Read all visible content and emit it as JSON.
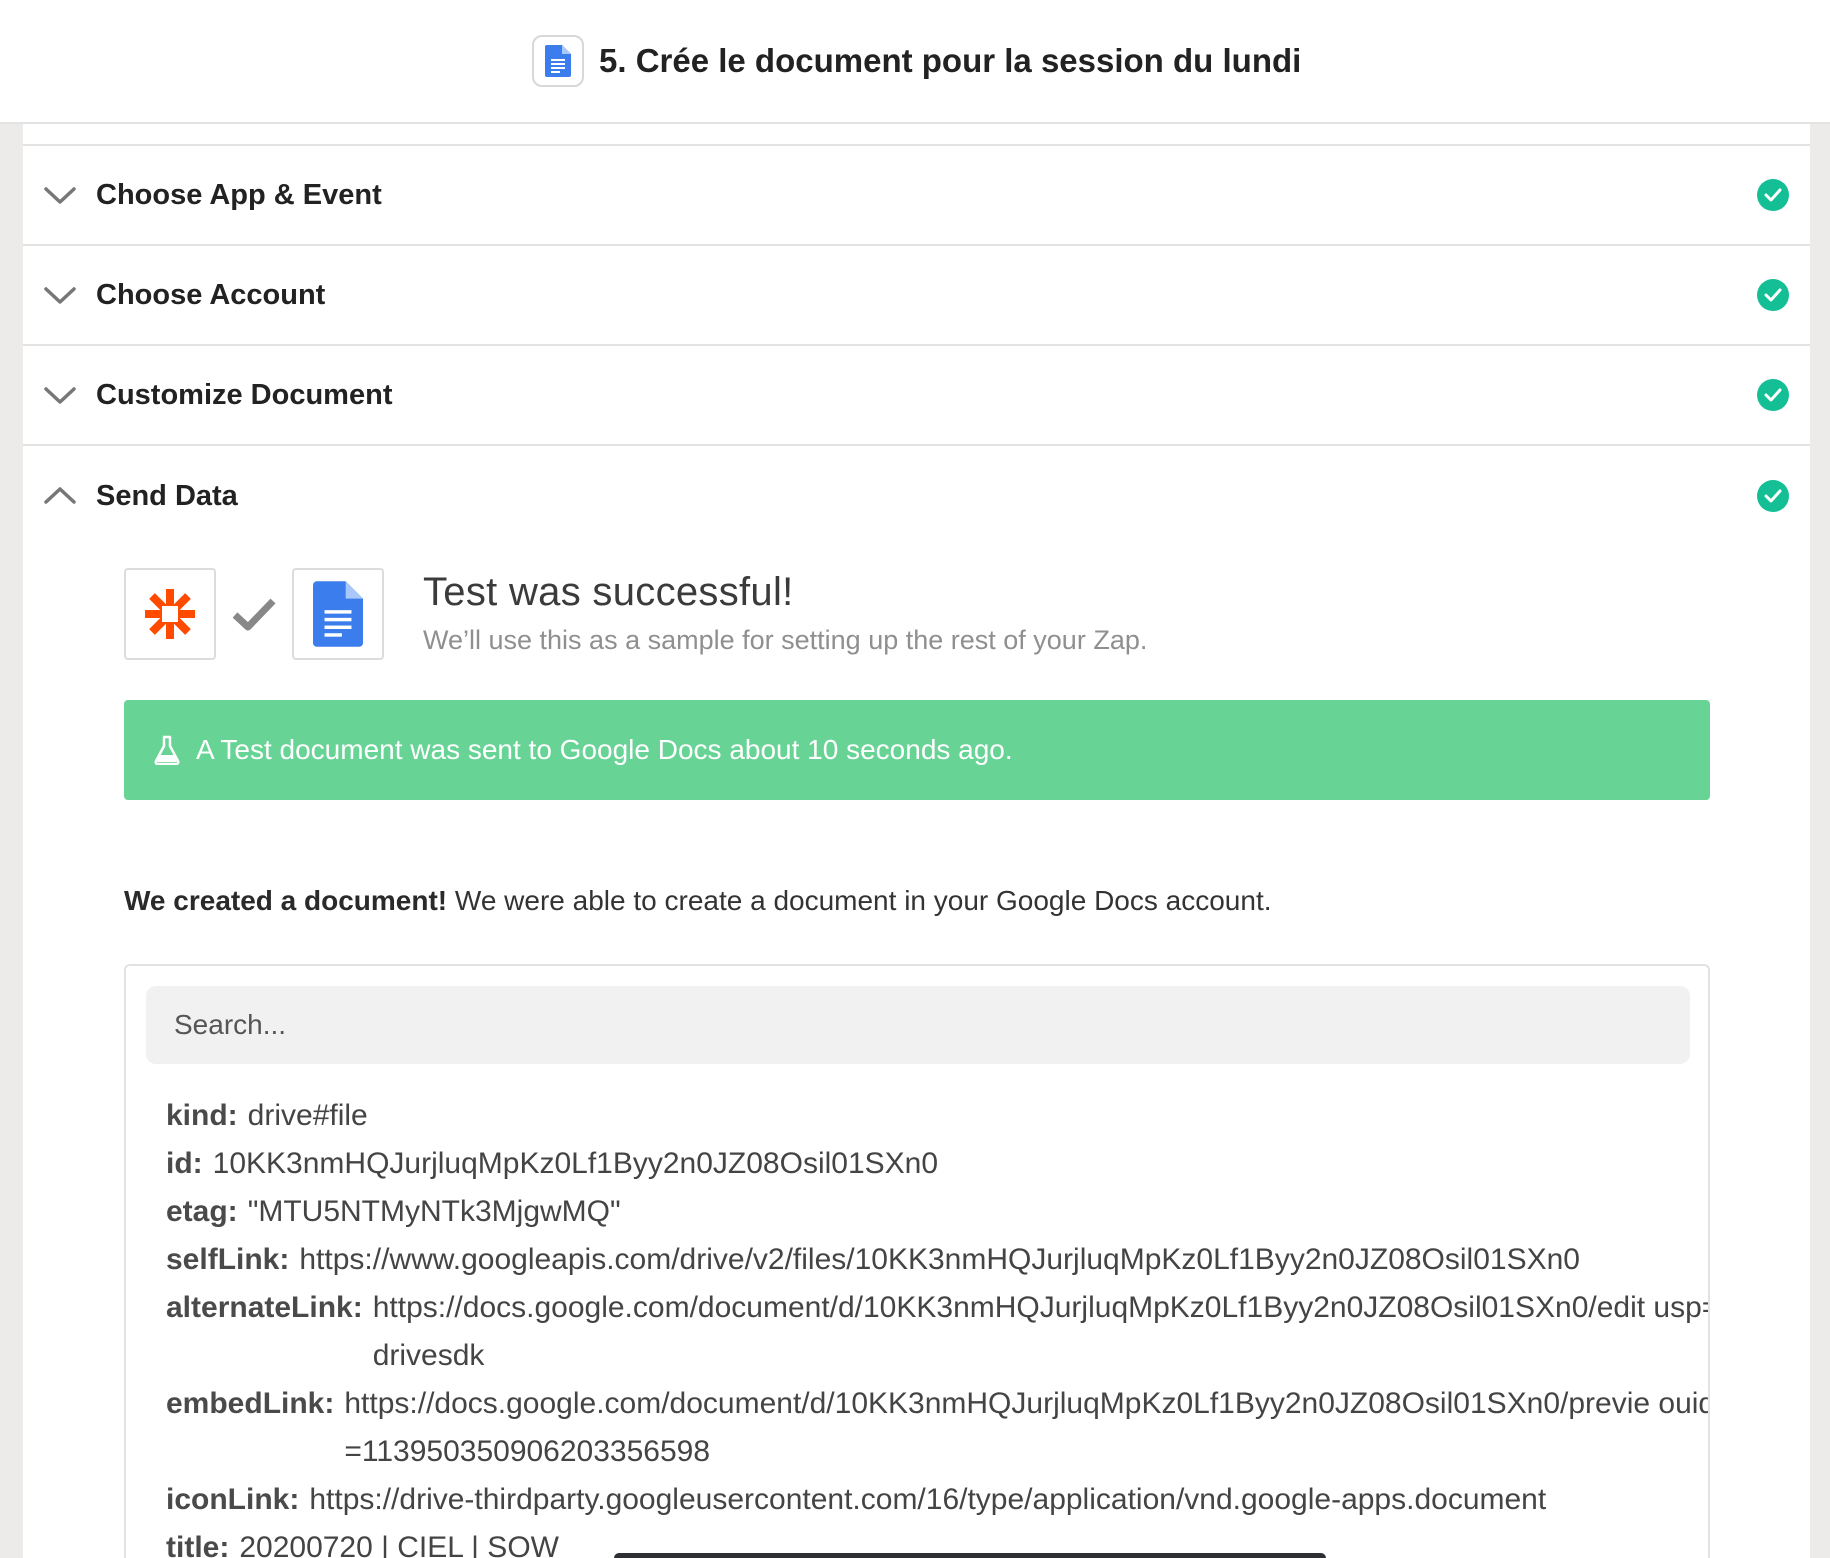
{
  "header": {
    "title": "5. Crée le document pour la session du lundi",
    "icon": "google-docs-icon"
  },
  "sections": [
    {
      "label": "Choose App & Event",
      "state": "collapsed",
      "complete": true
    },
    {
      "label": "Choose Account",
      "state": "collapsed",
      "complete": true
    },
    {
      "label": "Customize Document",
      "state": "collapsed",
      "complete": true
    },
    {
      "label": "Send Data",
      "state": "expanded",
      "complete": true
    }
  ],
  "send_data": {
    "success_title": "Test was successful!",
    "success_subtitle": "We’ll use this as a sample for setting up the rest of your Zap.",
    "banner_text": "A Test document was sent to Google Docs about 10 seconds ago.",
    "created_bold": "We created a document!",
    "created_rest": " We were able to create a document in your Google Docs account.",
    "search_placeholder": "Search...",
    "fields": [
      {
        "key": "kind:",
        "value": "drive#file"
      },
      {
        "key": "id:",
        "value": "10KK3nmHQJurjluqMpKz0Lf1Byy2n0JZ08Osil01SXn0"
      },
      {
        "key": "etag:",
        "value": "\"MTU5NTMyNTk3MjgwMQ\""
      },
      {
        "key": "selfLink:",
        "value": "https://www.googleapis.com/drive/v2/files/10KK3nmHQJurjluqMpKz0Lf1Byy2n0JZ08Osil01SXn0"
      },
      {
        "key": "alternateLink:",
        "value": "https://docs.google.com/document/d/10KK3nmHQJurjluqMpKz0Lf1Byy2n0JZ08Osil01SXn0/edit usp=drivesdk"
      },
      {
        "key": "embedLink:",
        "value": "https://docs.google.com/document/d/10KK3nmHQJurjluqMpKz0Lf1Byy2n0JZ08Osil01SXn0/previe ouid=113950350906203356598"
      },
      {
        "key": "iconLink:",
        "value": "https://drive-thirdparty.googleusercontent.com/16/type/application/vnd.google-apps.document"
      },
      {
        "key": "title:",
        "value": "20200720 | CIEL | SOW"
      }
    ]
  },
  "colors": {
    "success_green": "#14bf95",
    "banner_green": "#67d496",
    "zapier_orange": "#ff4a00",
    "docs_blue": "#3b7ded"
  }
}
